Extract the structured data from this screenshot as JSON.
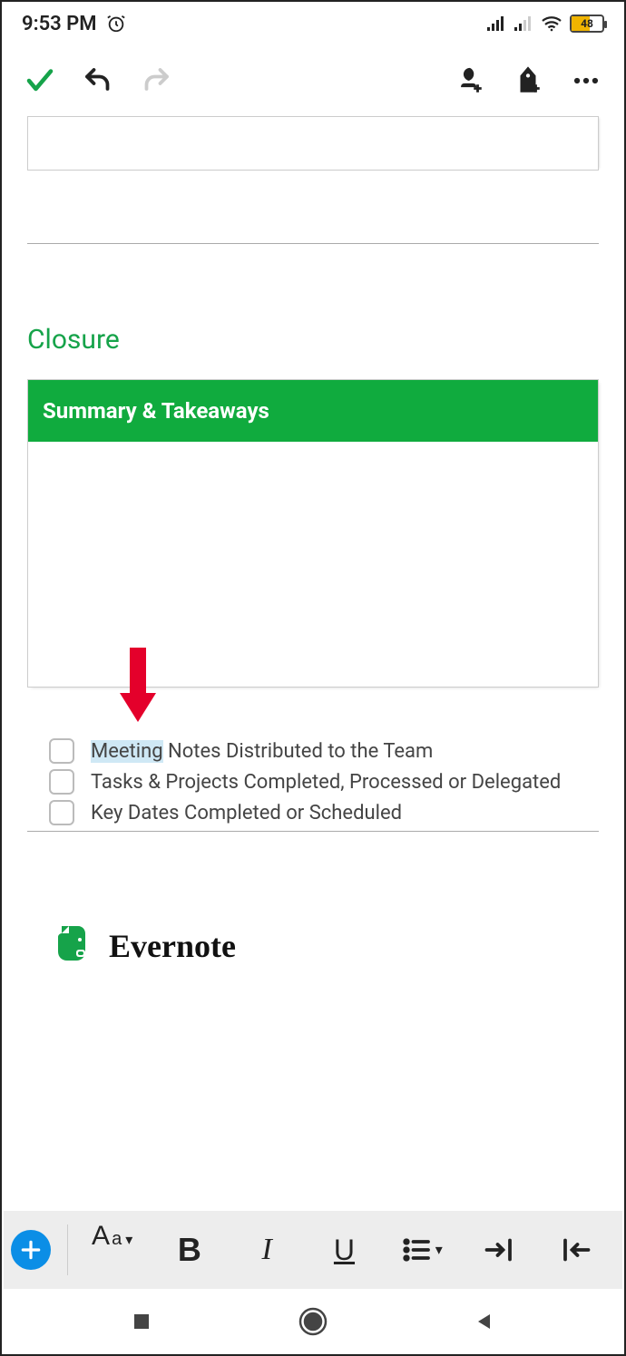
{
  "status": {
    "time": "9:53 PM",
    "battery_text": "48"
  },
  "section": {
    "title": "Closure",
    "summary_header": "Summary & Takeaways"
  },
  "checklist": {
    "items": [
      {
        "highlighted_word": "Meeting",
        "rest": " Notes Distributed to the Team"
      },
      {
        "highlighted_word": "",
        "rest": "Tasks & Projects Completed, Processed or Delegated"
      },
      {
        "highlighted_word": "",
        "rest": "Key Dates Completed or Scheduled"
      }
    ]
  },
  "brand": {
    "name": "Evernote"
  },
  "format": {
    "text_style_label": "Aa",
    "bold": "B",
    "italic": "I",
    "underline": "U"
  }
}
